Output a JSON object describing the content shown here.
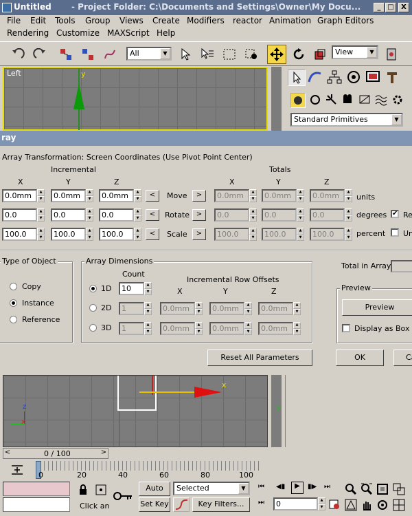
{
  "window": {
    "app_title": "Untitled",
    "path_title": "- Project Folder: C:\\Documents and Settings\\Owner\\My Docu...",
    "controls": [
      "_",
      "□",
      "X"
    ]
  },
  "menu": {
    "items": [
      "File",
      "Edit",
      "Tools",
      "Group",
      "Views",
      "Create",
      "Modifiers",
      "reactor",
      "Animation",
      "Graph Editors",
      "Rendering",
      "Customize",
      "MAXScript",
      "Help"
    ]
  },
  "toolbar": {
    "selection_filter": "All",
    "coord_system": "View"
  },
  "viewport_top": {
    "label": "Left",
    "y_axis": "y"
  },
  "command_panel": {
    "category": "Standard Primitives"
  },
  "array_dialog": {
    "title": "ray",
    "transform_group": "Array Transformation: Screen Coordinates (Use Pivot Point Center)",
    "incremental": "Incremental",
    "totals": "Totals",
    "axis_x": "X",
    "axis_y": "Y",
    "axis_z": "Z",
    "move_label": "Move",
    "rotate_label": "Rotate",
    "scale_label": "Scale",
    "units_move": "units",
    "units_rotate": "degrees",
    "units_scale": "percent",
    "arrow_left": "<",
    "arrow_right": ">",
    "re_label": "Re",
    "un_label": "Un",
    "move_inc": [
      "0.0mm",
      "0.0mm",
      "0.0mm"
    ],
    "rotate_inc": [
      "0.0",
      "0.0",
      "0.0"
    ],
    "scale_inc": [
      "100.0",
      "100.0",
      "100.0"
    ],
    "move_tot": [
      "0.0mm",
      "0.0mm",
      "0.0mm"
    ],
    "rotate_tot": [
      "0.0",
      "0.0",
      "0.0"
    ],
    "scale_tot": [
      "100.0",
      "100.0",
      "100.0"
    ],
    "type_group": "Type of Object",
    "copy": "Copy",
    "instance": "Instance",
    "reference": "Reference",
    "dims_group": "Array Dimensions",
    "count": "Count",
    "row_offsets": "Incremental Row Offsets",
    "d1": "1D",
    "d2": "2D",
    "d3": "3D",
    "count_1d": "10",
    "count_2d": "1",
    "count_3d": "1",
    "offsets_2d": [
      "0.0mm",
      "0.0mm",
      "0.0mm"
    ],
    "offsets_3d": [
      "0.0mm",
      "0.0mm",
      "0.0mm"
    ],
    "total_in_array": "Total in Array:",
    "preview_group": "Preview",
    "preview_button": "Preview",
    "display_as_box": "Display as Box",
    "reset_button": "Reset All Parameters",
    "ok_button": "OK",
    "cancel_button": "Ca"
  },
  "viewport_bottom": {
    "z_label": "z",
    "x_label": "x",
    "y_label": "y"
  },
  "timeline": {
    "frame": "0 / 100",
    "ticks": [
      "0",
      "20",
      "40",
      "60",
      "80",
      "100"
    ]
  },
  "status": {
    "click_text": "Click an",
    "auto_key": "Auto Key",
    "set_key": "Set Key",
    "key_mode": "Selected",
    "key_filters": "Key Filters...",
    "frame_value": "0"
  },
  "colors": {
    "active_yellow": "#f5d84a",
    "title_blue": "#5a6d8c",
    "viewport_grey": "#7c7c7c"
  }
}
